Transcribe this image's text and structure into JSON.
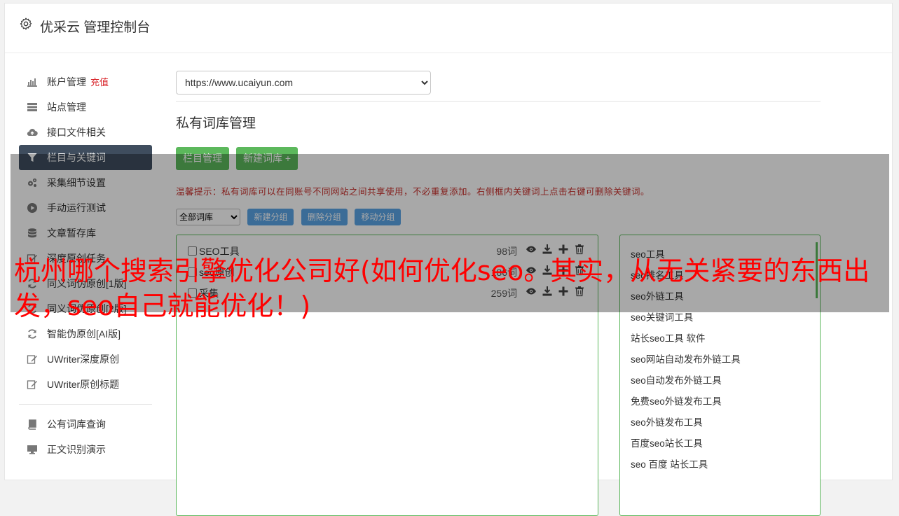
{
  "header": {
    "title": "优采云 管理控制台",
    "icon": "gear-icon"
  },
  "sidebar": {
    "items": [
      {
        "label": "账户管理",
        "extra": "充值",
        "icon": "bar-chart-icon"
      },
      {
        "label": "站点管理",
        "icon": "server-icon"
      },
      {
        "label": "接口文件相关",
        "icon": "cloud-upload-icon"
      },
      {
        "label": "栏目与关键词",
        "icon": "filter-icon",
        "active": true
      },
      {
        "label": "采集细节设置",
        "icon": "gears-icon"
      },
      {
        "label": "手动运行测试",
        "icon": "play-circle-icon"
      },
      {
        "label": "文章暂存库",
        "icon": "database-icon"
      },
      {
        "label": "深度原创任务",
        "icon": "edit-icon"
      },
      {
        "label": "同义词伪原创[1版]",
        "icon": "refresh-icon"
      },
      {
        "label": "同义词伪原创[2版]",
        "icon": "refresh-icon"
      },
      {
        "label": "智能伪原创[AI版]",
        "icon": "refresh-icon"
      },
      {
        "label": "UWriter深度原创",
        "icon": "edit-icon"
      },
      {
        "label": "UWriter原创标题",
        "icon": "edit-icon"
      }
    ],
    "items2": [
      {
        "label": "公有词库查询",
        "icon": "book-icon"
      },
      {
        "label": "正文识别演示",
        "icon": "monitor-icon"
      }
    ]
  },
  "main": {
    "site_select": "https://www.ucaiyun.com",
    "section_title": "私有词库管理",
    "btn_column": "栏目管理",
    "btn_new_lib": "新建词库 +",
    "tip": "温馨提示：私有词库可以在同账号不同网站之间共享使用，不必重复添加。右侧框内关键词上点击右键可删除关键词。",
    "filter_select": "全部词库",
    "btn_new_group": "新建分组",
    "btn_delete_group": "删除分组",
    "btn_move_group": "移动分组",
    "libraries": [
      {
        "name": "SEO工具",
        "count": "98词"
      },
      {
        "name": "seo原创",
        "count": "186词"
      },
      {
        "name": "采集",
        "count": "259词"
      }
    ],
    "keywords": [
      "seo工具",
      "seo排名工具",
      "seo外链工具",
      "seo关键词工具",
      "站长seo工具 软件",
      "seo网站自动发布外链工具",
      "seo自动发布外链工具",
      "免费seo外链发布工具",
      "seo外链发布工具",
      "百度seo站长工具",
      "seo 百度 站长工具"
    ]
  },
  "overlay": {
    "headline": "杭州哪个搜索引擎优化公司好(如何优化seo。其实，从无关紧要的东西出发，seo自己就能优化！)"
  },
  "colors": {
    "sidebar_active": "#3f4d5e",
    "green": "#5cb85c",
    "blue": "#5aa5e6",
    "recharge_red": "#d9262c",
    "headline_red": "#ff0000"
  }
}
